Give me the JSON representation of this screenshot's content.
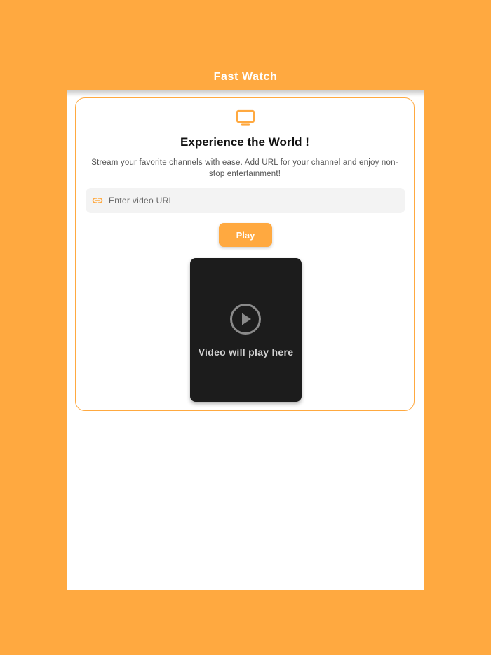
{
  "app": {
    "title": "Fast Watch"
  },
  "card": {
    "icon": "tv-icon",
    "headline": "Experience the World !",
    "subtext": "Stream your favorite channels with ease. Add URL for your channel and enjoy non-stop entertainment!"
  },
  "url_input": {
    "icon": "link-icon",
    "placeholder": "Enter video URL",
    "value": ""
  },
  "play_button": {
    "label": "Play"
  },
  "video": {
    "icon": "play-circle-icon",
    "placeholder_text": "Video will play here"
  },
  "colors": {
    "accent": "#FFA940",
    "video_bg": "#1C1C1C",
    "input_bg": "#F3F3F3"
  }
}
